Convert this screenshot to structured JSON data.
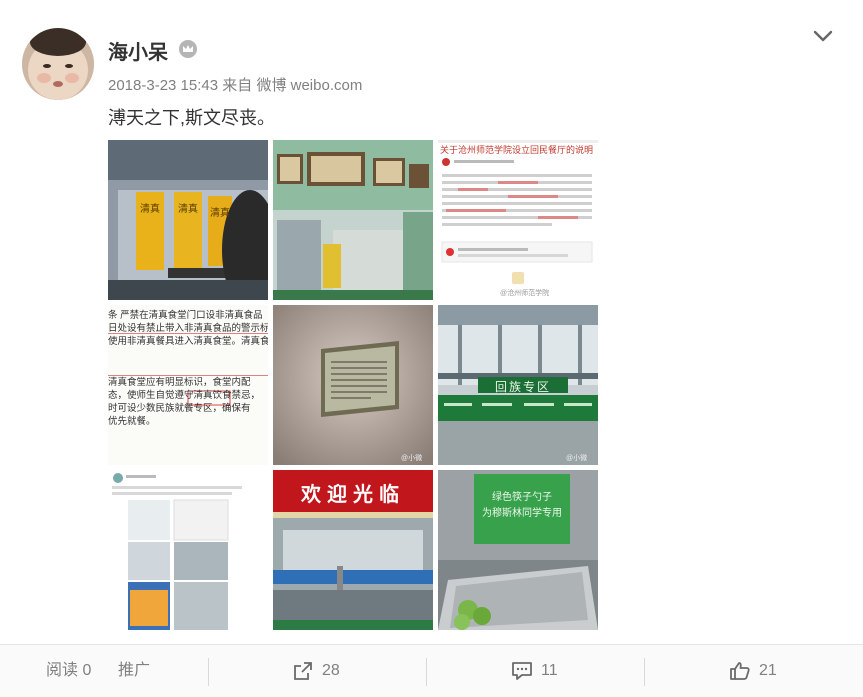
{
  "post": {
    "username": "海小呆",
    "timestamp": "2018-3-23 15:43",
    "source_prefix": "来自",
    "source": "微博 weibo.com",
    "text": "溥天之下,斯文尽丧。",
    "icons": {
      "avatar": "avatar-baby",
      "vip": "crown-icon",
      "menu": "chevron-down-icon"
    }
  },
  "images": {
    "img1": {
      "labels": [
        "清真",
        "清真",
        "清真"
      ]
    },
    "img2": {
      "labels": []
    },
    "img3": {
      "title": "关于沧州师范学院设立回民餐厅的说明",
      "watermark": "@沧州师范学院"
    },
    "img4": {
      "lines": [
        "条   严禁在清真食堂门口设非清真食品",
        "日处设有禁止带入非清真食品的警示标",
        "使用非清真餐具进入清真食堂。清真食堂",
        "清真食堂应有明显标识，食堂内配",
        "态，使师生自觉遵守清真饮食禁忌，",
        "时可设少数民族就餐专区，确保有",
        "优先就餐。"
      ]
    },
    "img5": {
      "watermark": "@小微"
    },
    "img6": {
      "banner": "回族专区",
      "watermark": "@小微"
    },
    "img7": {
      "labels": []
    },
    "img8": {
      "banner": "欢迎光临"
    },
    "img9": {
      "sign_line1": "绿色筷子勺子",
      "sign_line2": "为穆斯林同学专用"
    }
  },
  "actions": {
    "read_label": "阅读",
    "read_count": "0",
    "promote_label": "推广",
    "repost_count": "28",
    "comment_count": "11",
    "like_count": "21",
    "icons": {
      "repost": "share-icon",
      "comment": "comment-icon",
      "like": "thumbs-up-icon"
    }
  },
  "colors": {
    "text": "#333333",
    "meta": "#808080",
    "accent": "#eb7350"
  }
}
